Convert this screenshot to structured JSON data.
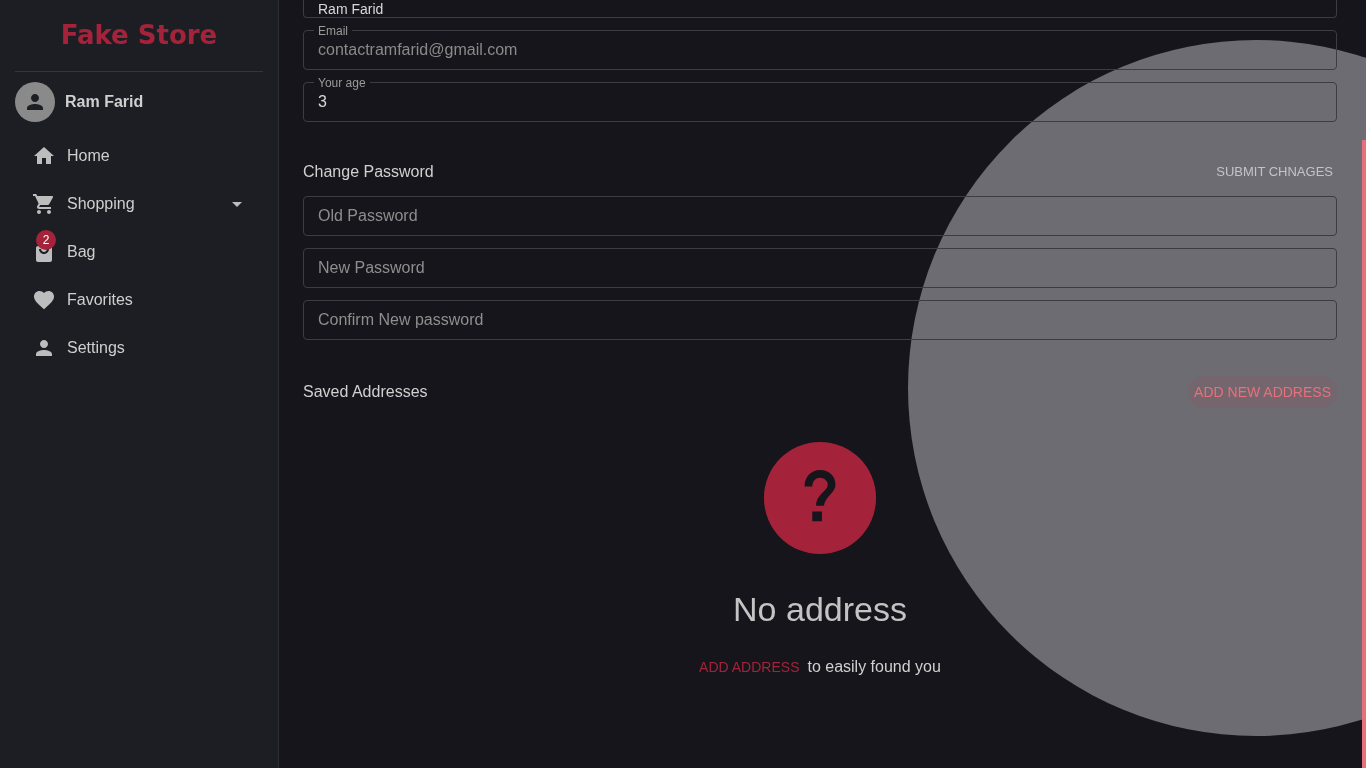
{
  "sidebar": {
    "brand": "Fake Store",
    "user": {
      "name": "Ram Farid"
    },
    "items": [
      {
        "kind": "home",
        "label": "Home",
        "expandable": false
      },
      {
        "kind": "cart",
        "label": "Shopping",
        "expandable": true
      },
      {
        "kind": "bag",
        "label": "Bag",
        "expandable": false,
        "badge": "2"
      },
      {
        "kind": "heart",
        "label": "Favorites",
        "expandable": false
      },
      {
        "kind": "person",
        "label": "Settings",
        "expandable": false
      }
    ]
  },
  "profile_fields": [
    {
      "value": "Ram Farid",
      "muted": false
    },
    {
      "label": "Email",
      "value": "contactramfarid@gmail.com",
      "muted": true
    },
    {
      "label": "Your age",
      "value": "3",
      "muted": false
    }
  ],
  "password": {
    "title": "Change Password",
    "submit": "SUBMIT CHNAGES",
    "fields": [
      {
        "placeholder": "Old Password"
      },
      {
        "placeholder": "New Password"
      },
      {
        "placeholder": "Confirm New password"
      }
    ]
  },
  "addresses": {
    "title": "Saved Addresses",
    "add_button": "ADD NEW ADDRESS",
    "empty": {
      "heading": "No address",
      "link": "ADD ADDRESS",
      "text": "to easily found you"
    }
  }
}
